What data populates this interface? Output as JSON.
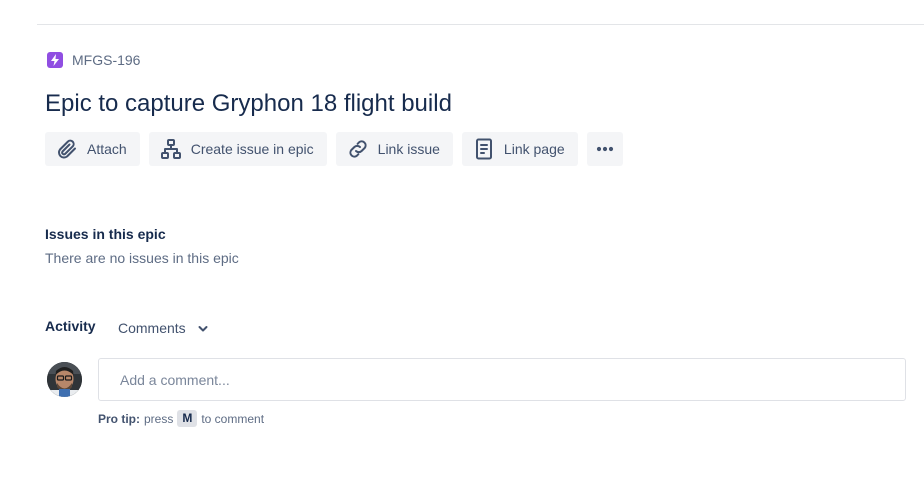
{
  "issue": {
    "key": "MFGS-196",
    "type_icon": "lightning-icon",
    "type_color": "#904ee2",
    "title": "Epic to capture Gryphon 18 flight build"
  },
  "toolbar": {
    "attach_label": "Attach",
    "attach_icon": "paperclip-icon",
    "create_issue_label": "Create issue in epic",
    "create_issue_icon": "hierarchy-icon",
    "link_issue_label": "Link issue",
    "link_issue_icon": "link-icon",
    "link_page_label": "Link page",
    "link_page_icon": "page-icon",
    "more_icon": "more-icon"
  },
  "epic_issues": {
    "heading": "Issues in this epic",
    "empty_text": "There are no issues in this epic"
  },
  "activity": {
    "label": "Activity",
    "filter_value": "Comments",
    "comment_placeholder": "Add a comment...",
    "protip_label": "Pro tip:",
    "protip_press": "press",
    "protip_key": "M",
    "protip_suffix": "to comment"
  },
  "colors": {
    "text_primary": "#172b4d",
    "text_secondary": "#5e6c84",
    "button_bg": "#f4f5f7",
    "epic_purple": "#904ee2"
  }
}
